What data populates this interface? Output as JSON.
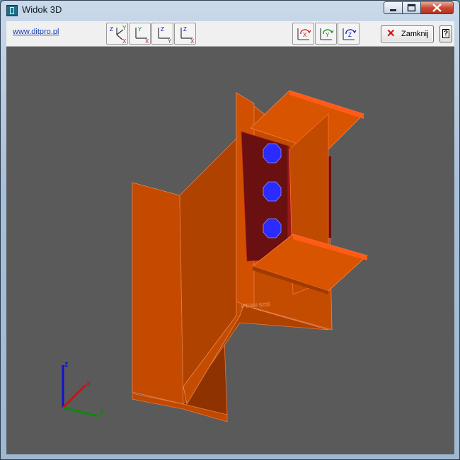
{
  "window": {
    "title": "Widok 3D"
  },
  "toolbar": {
    "link_text": "www.ditpro.pl",
    "view_buttons": [
      {
        "id": "iso",
        "name": "isometric-view-button"
      },
      {
        "id": "xy",
        "name": "view-xy-button"
      },
      {
        "id": "yz",
        "name": "view-yz-button"
      },
      {
        "id": "xz",
        "name": "view-xz-button"
      }
    ],
    "rotate_buttons": [
      {
        "id": "rx",
        "name": "rotate-x-button"
      },
      {
        "id": "ry",
        "name": "rotate-y-button"
      },
      {
        "id": "rz",
        "name": "rotate-z-button"
      }
    ],
    "close_label": "Zamknij",
    "help_label": "?"
  },
  "scene": {
    "section_label": "IPE300 S235",
    "axis_labels": {
      "x": "x",
      "y": "y",
      "z": "z"
    },
    "colors": {
      "background": "#5a5a5a",
      "steel_dark": "#8e3200",
      "steel_mid": "#b84400",
      "steel_light": "#d45400",
      "steel_bright": "#ff5b17",
      "end_plate": "#6a1010",
      "bolt": "#2b2bff",
      "axis_x": "#d01010",
      "axis_y": "#0b8a0b",
      "axis_z": "#1010d0"
    }
  }
}
